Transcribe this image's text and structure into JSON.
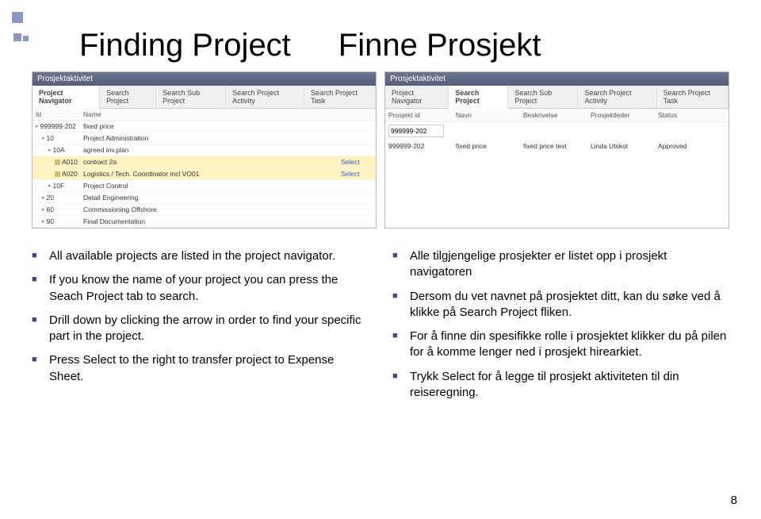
{
  "decor": true,
  "headings": {
    "left": "Finding Project",
    "right": "Finne Prosjekt"
  },
  "leftShot": {
    "title": "Prosjektaktivitet",
    "tabs": [
      "Project Navigator",
      "Search Project",
      "Search Sub Project",
      "Search Project Activity",
      "Search Project Task"
    ],
    "activeTab": 0,
    "cols": {
      "id": "Id",
      "name": "Name"
    },
    "rows": [
      {
        "id": "999999-202",
        "name": "fixed price",
        "indent": 0,
        "hl": false,
        "select": ""
      },
      {
        "id": "10",
        "name": "Project Administration",
        "indent": 1,
        "hl": false,
        "select": ""
      },
      {
        "id": "10A",
        "name": "agreed inv.plan",
        "indent": 2,
        "hl": false,
        "select": ""
      },
      {
        "id": "A010",
        "name": "contract 2a",
        "indent": 3,
        "hl": true,
        "select": "Select"
      },
      {
        "id": "A020",
        "name": "Logistics / Tech. Coordinator incl VO01",
        "indent": 3,
        "hl": true,
        "select": "Select"
      },
      {
        "id": "10F",
        "name": "Project Control",
        "indent": 2,
        "hl": false,
        "select": ""
      },
      {
        "id": "20",
        "name": "Detail Engineering",
        "indent": 1,
        "hl": false,
        "select": ""
      },
      {
        "id": "60",
        "name": "Commissioning Offshore",
        "indent": 1,
        "hl": false,
        "select": ""
      },
      {
        "id": "90",
        "name": "Final Documentation",
        "indent": 1,
        "hl": false,
        "select": ""
      }
    ]
  },
  "rightShot": {
    "title": "Prosjektaktivitet",
    "tabs": [
      "Project Navigator",
      "Search Project",
      "Search Sub Project",
      "Search Project Activity",
      "Search Project Task"
    ],
    "activeTab": 1,
    "cols": [
      "Prosjekt id",
      "Navn",
      "Beskrivelse",
      "Prosjektleder",
      "Status"
    ],
    "searchValue": "999999-202",
    "result": {
      "id": "999999-202",
      "name": "fixed price",
      "desc": "fixed price test",
      "leader": "Linda Utskot",
      "status": "Approved"
    }
  },
  "bulletsLeft": [
    "All available projects are listed in the project navigator.",
    "If you know the name of your project you can press the Seach Project tab to search.",
    "Drill down by clicking the arrow in order to find your specific part in the project.",
    "Press Select to the right to transfer project to Expense Sheet."
  ],
  "bulletsRight": [
    "Alle tilgjengelige prosjekter er listet opp i prosjekt navigatoren",
    "Dersom du vet navnet på prosjektet ditt, kan du søke ved å klikke på Search Project fliken.",
    "For å finne din spesifikke rolle i prosjektet klikker du på pilen for å komme lenger ned i prosjekt hirearkiet.",
    "Trykk Select for å legge til prosjekt aktiviteten til din reiseregning."
  ],
  "pageNumber": "8"
}
